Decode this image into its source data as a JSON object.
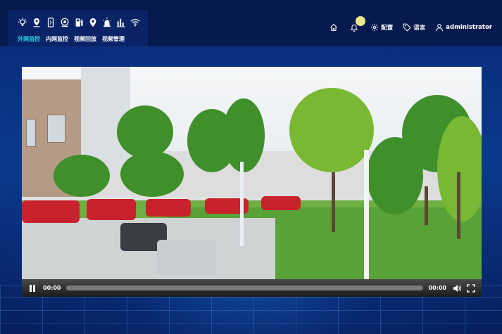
{
  "header": {
    "nav_tabs": [
      {
        "label": "外网监控",
        "active": true
      },
      {
        "label": "内网监控",
        "active": false
      },
      {
        "label": "视频回放",
        "active": false
      },
      {
        "label": "视频管理",
        "active": false
      }
    ],
    "toolbar_icons": [
      "light-bulb-icon",
      "location-pin-icon",
      "phone-icon",
      "camera-icon",
      "fuel-pump-icon",
      "map-marker-icon",
      "alarm-light-icon",
      "bar-chart-icon",
      "wifi-icon"
    ],
    "menu": {
      "config_label": "配置",
      "language_label": "语言",
      "user_label": "administrator"
    },
    "active_color": "#26d8e8",
    "notification_dot_color": "#f0e68c"
  },
  "player": {
    "current_time": "00:00",
    "duration": "00:00",
    "progress": 0
  }
}
